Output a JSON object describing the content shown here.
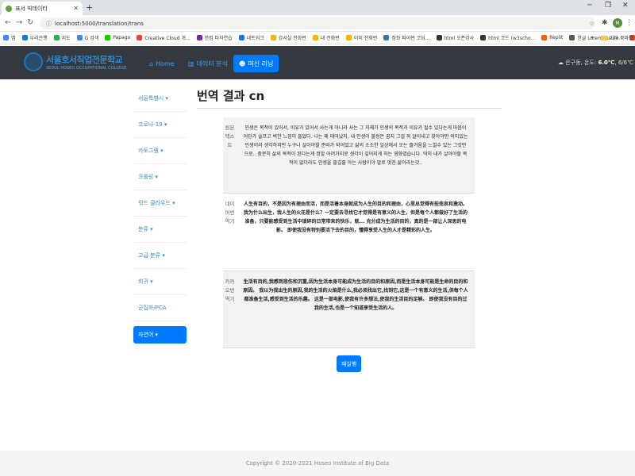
{
  "browser": {
    "tab_title": "표서 빅데이터",
    "url": "localhost:5000/translation/trans",
    "avatar_letter": "M",
    "bookmarks": [
      "앱",
      "우리은행",
      "지도",
      "G 검색",
      "Papago",
      "Creative Cloud 개...",
      "한컴 타자연습",
      "네트워크",
      "강서실 전화번",
      "내 전화번",
      "이미 전화번",
      "정좌 파이썬 코딩...",
      "html 오픈강사",
      "html 코드 (w3scho...",
      "Replit",
      "한글 Lorem Ipsum...",
      "ppt"
    ],
    "bookmarks_more": "»",
    "other_bookmarks": "기타 북마크"
  },
  "site": {
    "logo_ko": "서울호서직업전문학교",
    "logo_en": "SEOUL HOSEO OCCUPATIONAL COLLEGE",
    "nav": [
      {
        "label": "Home",
        "icon": "home-icon"
      },
      {
        "label": "데이터 분석",
        "icon": "chart-icon"
      },
      {
        "label": "머신 러닝",
        "icon": "robot-icon"
      }
    ],
    "weather": {
      "location": "은구동, 온도:",
      "temp": "6.0℃",
      "range": "6/6℃"
    }
  },
  "sidebar": {
    "items": [
      "서울특별시 ▾",
      "코로나-19 ▾",
      "카토그램 ▾",
      "크롤링 ▾",
      "워드 클라우드 ▾",
      "분류 ▾",
      "고급 분류 ▾",
      "회귀 ▾",
      "군집화/PCA",
      "자연어 ▾"
    ]
  },
  "main": {
    "title": "번역 결과 cn",
    "rows": [
      {
        "label": "원본텍스트",
        "text": "인생은 목적이 있어서, 이유가 있어서 사는게 아니라 사는 그 자체가 인생의 목적과 이유가 될수 있다는게 마음이 어딘가 슬프고 벅찬 느낌이 들었다. 나는 왜 태어났지, 내 인생이 불쌍은 꿈지 그걸 꼭 알아내고 찾아야만 의미있는 인생이라 생각하지만 누구나 살아야할 준비가 되어었고 삶의 소소한 일상에서 오는 즐거움을 느낄수 있는 그것만으로.. 충분히 삶의 목적이 된다는게 정말 어려가지로 생각이 깊어지게 하는 영화였습니다. 딱히 내가 살아야할 목적이 없더라도 인생을 즐길줄 아는 사람이야 말로 멋진 삶이라는것.."
      },
      {
        "label": "네이버번역기",
        "text": "人生有目的，不是因为有理由而活，而是活着本身就成为人生的目的和理由，心里总觉得有些悲哀和激动。 我为什么出生，我人生的火花是什么？一定要去寻找它才觉得是有意义的人生，但是每个人都做好了生活的准备，只要能感受到生活中琐碎的日常带来的快乐，就... 充分成为生活的目的，真的是一部让人深思的电影。 即使我没有特别要活下去的目的，懂得享受人生的人才是精彩的人生。"
      },
      {
        "label": "카카오번역기",
        "text": "生活有目的,我感到悲伤和沉重,因为生活本身可能成为生活的目的和原因,而是生活本身可能是生命的目的和原因。 我以为我出生的原因,我的生活的火焰是什么,我必须找出它,找到它,这是一个有意义的生活,但每个人都准备生活,感受到生活的乐趣。 这是一部电影,使我有许多想法,使我的生活目的足够。 即使我没有目的过我的生活,也是一个知道享受生活的人。"
      }
    ],
    "retry_label": "재실행"
  },
  "footer": {
    "text": "Copyright © 2020-2021 Hoseo Institute of Big Data"
  }
}
